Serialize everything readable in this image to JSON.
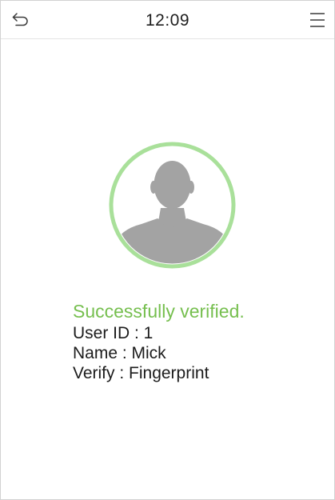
{
  "header": {
    "time": "12:09",
    "back_icon": "back-arrow-icon",
    "menu_icon": "menu-icon"
  },
  "avatar": {
    "icon": "user-silhouette-icon",
    "ring_color": "#a9e09a"
  },
  "result": {
    "status": "Successfully verified.",
    "status_color": "#76bf4f",
    "user_id_line": "User ID : 1",
    "name_line": "Name : Mick",
    "verify_line": "Verify : Fingerprint"
  }
}
